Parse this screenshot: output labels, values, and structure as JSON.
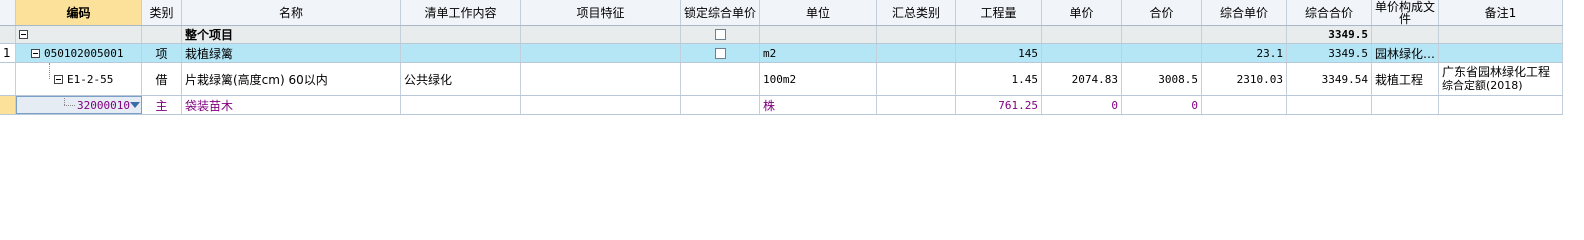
{
  "columns": [
    "编码",
    "类别",
    "名称",
    "清单工作内容",
    "项目特征",
    "锁定综合单价",
    "单位",
    "汇总类别",
    "工程量",
    "单价",
    "合价",
    "综合单价",
    "综合合价",
    "单价构成文件",
    "备注1"
  ],
  "rows": {
    "summary": {
      "name": "整个项目",
      "total": "3349.5"
    },
    "item": {
      "index": "1",
      "code": "050102005001",
      "type": "项",
      "name": "栽植绿篱",
      "unit": "m2",
      "qty": "145",
      "comp_price": "23.1",
      "comp_total": "3349.5",
      "price_file": "园林绿化…"
    },
    "quota": {
      "code": "E1-2-55",
      "type": "借",
      "name": "片栽绿篱(高度cm) 60以内",
      "work": "公共绿化",
      "unit": "100m2",
      "qty": "1.45",
      "price": "2074.83",
      "total": "3008.5",
      "comp_price": "2310.03",
      "comp_total": "3349.54",
      "price_file": "栽植工程",
      "note_line1": "广东省园林绿化工程",
      "note_line2": "综合定额(2018)"
    },
    "material": {
      "code": "32000010",
      "type": "主",
      "name": "袋装苗木",
      "unit": "株",
      "qty": "761.25",
      "price": "0",
      "total": "0"
    }
  },
  "colors": {
    "header_bg": "#f1f4f8",
    "active_header": "#fbe199",
    "item_row": "#b4e6f6",
    "summary_row": "#e8ecec",
    "material_text": "#800080"
  }
}
